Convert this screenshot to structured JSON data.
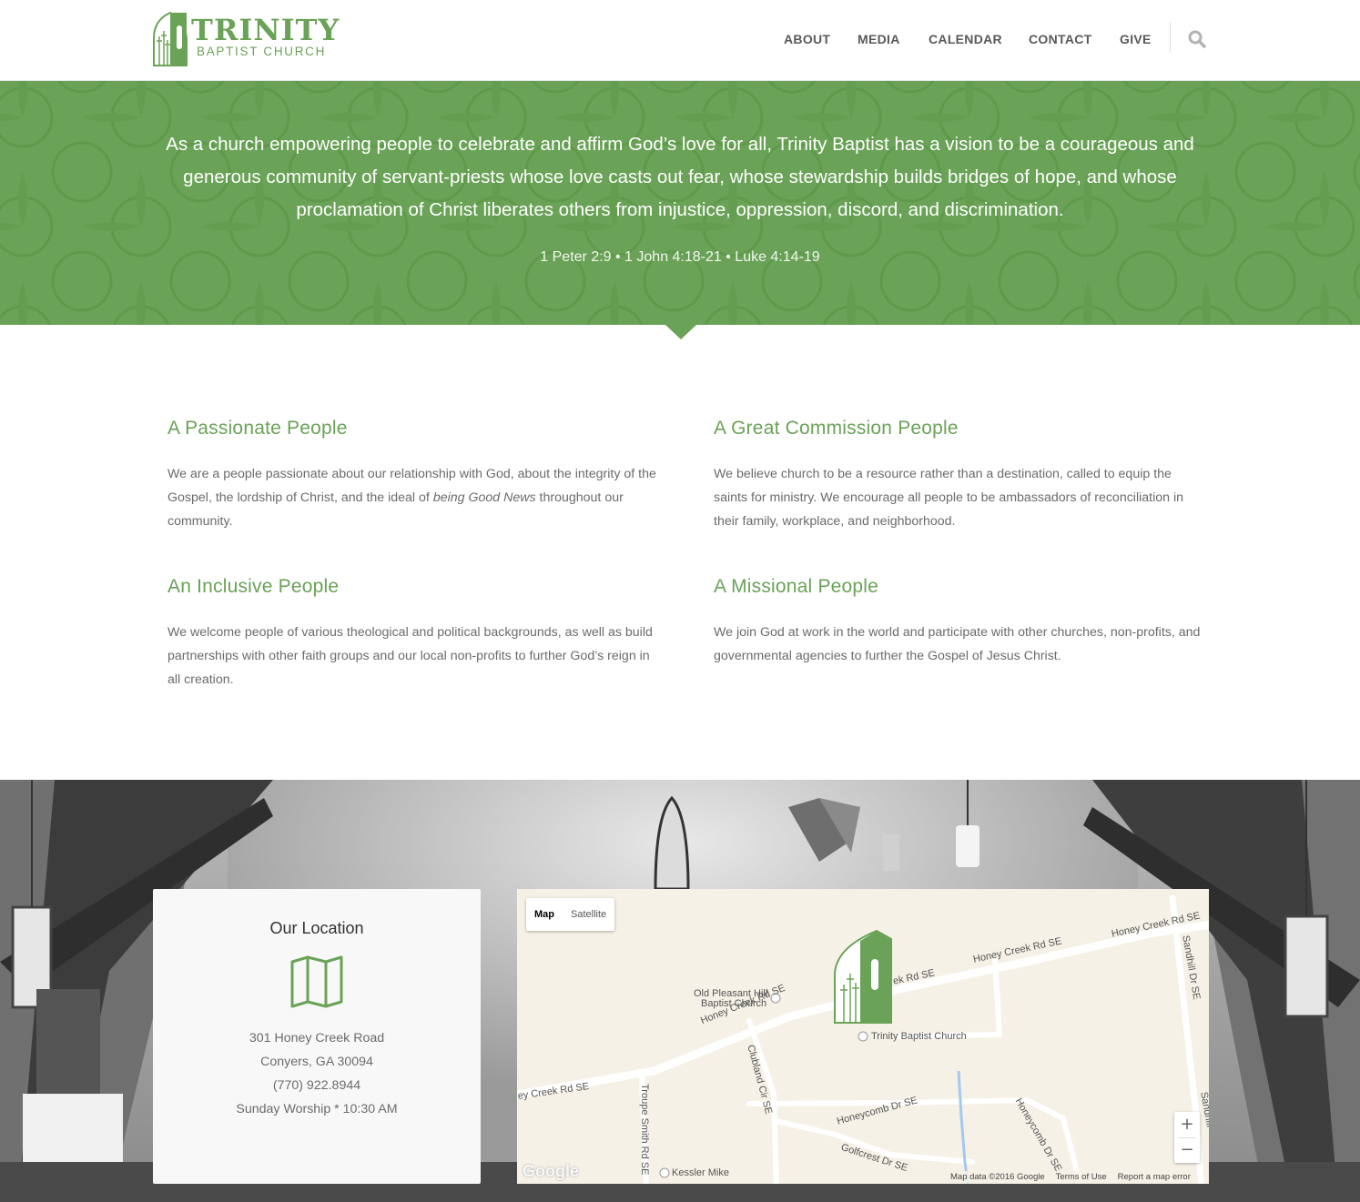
{
  "brand": {
    "name": "TRINITY",
    "subtitle": "BAPTIST CHURCH",
    "color": "#6aa257"
  },
  "nav": {
    "items": [
      "ABOUT",
      "MEDIA",
      "CALENDAR",
      "CONTACT",
      "GIVE"
    ],
    "search_icon": "search-icon"
  },
  "hero": {
    "vision": "As a church empowering people to celebrate and affirm God’s love for all, Trinity Baptist has a vision to be a courageous and generous community of servant-priests whose love casts out fear, whose stewardship builds bridges of hope, and whose proclamation of Christ liberates others from injustice, oppression, discord, and discrimination.",
    "references": "1 Peter 2:9 • 1 John 4:18-21 • Luke 4:14-19"
  },
  "values": [
    {
      "title": "A Passionate People",
      "text_before": "We are a people passionate about our relationship with God, about the integrity of the Gospel, the lordship of Christ, and the ideal of ",
      "text_emphasis": "being Good News",
      "text_after": " throughout our community."
    },
    {
      "title": "A Great Commission People",
      "text": "We believe church to be a resource rather than a destination, called to equip the saints for ministry.  We encourage all people to be ambassadors of reconciliation in their family, workplace, and neighborhood."
    },
    {
      "title": "An Inclusive People",
      "text": "We welcome people of various theological and political backgrounds, as well as build partnerships with other faith groups and our local non-profits to further God’s reign in all creation."
    },
    {
      "title": "A Missional People",
      "text": "We join God at work in the world and participate with other churches, non-profits, and governmental agencies to further the Gospel of Jesus Christ."
    }
  ],
  "location": {
    "title": "Our Location",
    "icon": "map-icon",
    "lines": [
      "301 Honey Creek Road",
      "Conyers, GA 30094",
      "(770) 922.8944",
      "Sunday Worship * 10:30 AM"
    ]
  },
  "map": {
    "type_buttons": [
      "Map",
      "Satellite"
    ],
    "active_type": "Map",
    "zoom_in": "+",
    "zoom_out": "−",
    "labels": {
      "old_pleasant_1": "Old Pleasant Hill",
      "old_pleasant_2": "Baptist Church",
      "trinity": "Trinity Baptist Church",
      "kessler": "Kessler Mike",
      "honey_creek_1": "Honey Creek Rd SE",
      "honey_creek_2": "Honey Creek Rd SE",
      "honey_creek_3": "Honey Creek Rd SE",
      "honey_creek_4": "ek Rd SE",
      "honey_creek_5": "ey Creek Rd SE",
      "clubland": "Clubland Cir SE",
      "troupe": "Troupe Smith Rd SE",
      "honeycomb_1": "Honeycomb Dr SE",
      "honeycomb_2": "Honeycomb Dr SE",
      "golfcrest": "Golfcrest Dr SE",
      "sandhill": "Sandhill Dr SE",
      "sandhill_2": "Sandhill"
    },
    "google": "Google",
    "footer": [
      "Map data ©2016 Google",
      "Terms of Use",
      "Report a map error"
    ]
  }
}
